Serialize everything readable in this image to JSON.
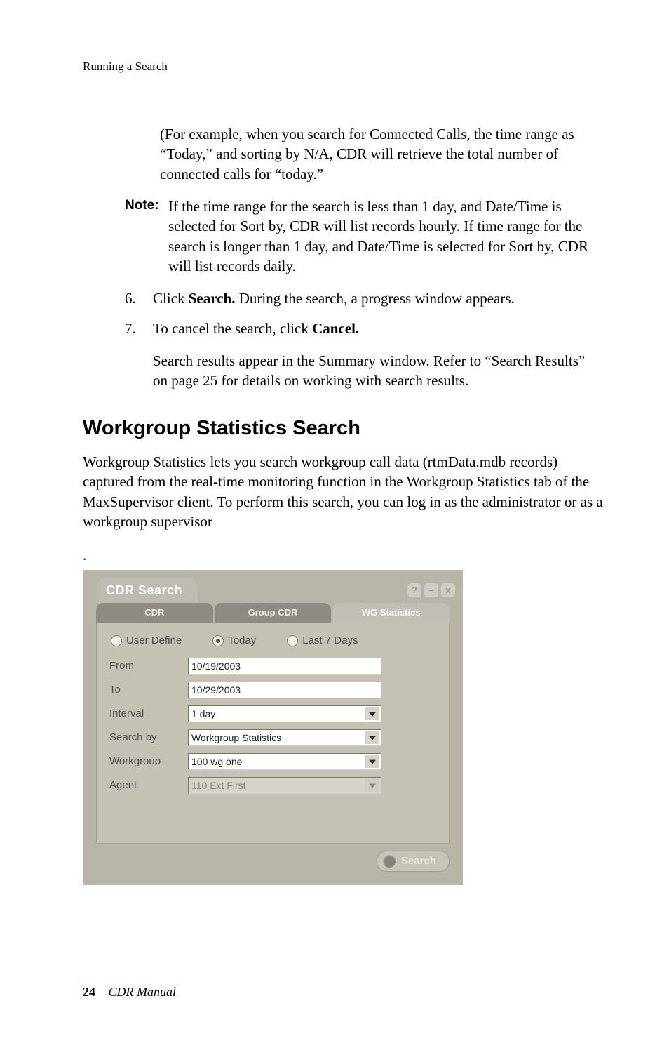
{
  "running_head": "Running a Search",
  "intro_para": "(For example, when you search for Connected Calls, the time range as “Today,” and sorting by N/A, CDR will retrieve the total number of connected calls for “today.”",
  "note": {
    "label": "Note:",
    "body": "If the time range for the search is less than 1 day, and Date/Time is selected for Sort by, CDR will list records hourly. If time range for the search is longer than 1 day, and Date/Time is selected for Sort by, CDR will list records daily."
  },
  "steps": [
    {
      "n": "6.",
      "pre": "Click ",
      "bold": "Search.",
      "post": " During the search, a progress window appears."
    },
    {
      "n": "7.",
      "pre": "To cancel the search, click ",
      "bold": "Cancel.",
      "post": ""
    }
  ],
  "after_steps": "Search results appear in the Summary window. Refer to “Search Results” on page 25 for details on working with search results.",
  "section_title": "Workgroup Statistics Search",
  "section_para": "Workgroup Statistics lets you search workgroup call data (rtmData.mdb records) captured from the real-time monitoring function in the Workgroup Statistics tab of the MaxSupervisor client. To perform this search, you can log in as the administrator or as a workgroup supervisor",
  "shot": {
    "title": "CDR Search",
    "win_buttons": [
      "?",
      "–",
      "x"
    ],
    "tabs": [
      "CDR",
      "Group CDR",
      "WG Statistics"
    ],
    "active_tab": 2,
    "radios": [
      {
        "label": "User Define",
        "selected": false
      },
      {
        "label": "Today",
        "selected": true
      },
      {
        "label": "Last 7 Days",
        "selected": false
      }
    ],
    "rows": {
      "from_label": "From",
      "from_value": "10/19/2003",
      "to_label": "To",
      "to_value": "10/29/2003",
      "interval_label": "Interval",
      "interval_value": "1 day",
      "searchby_label": "Search by",
      "searchby_value": "Workgroup Statistics",
      "workgroup_label": "Workgroup",
      "workgroup_value": "100   wg one",
      "agent_label": "Agent",
      "agent_value": "110   Ext First"
    },
    "search_button": "Search"
  },
  "footer": {
    "page": "24",
    "title": "CDR Manual"
  }
}
